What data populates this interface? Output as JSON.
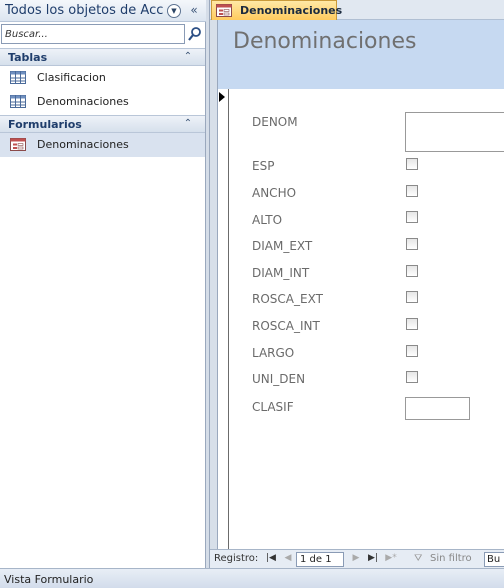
{
  "nav": {
    "title": "Todos los objetos de Acc...",
    "search_placeholder": "Buscar...",
    "groups": [
      {
        "label": "Tablas",
        "items": [
          {
            "label": "Clasificacion",
            "icon": "table-icon"
          },
          {
            "label": "Denominaciones",
            "icon": "table-icon"
          }
        ]
      },
      {
        "label": "Formularios",
        "items": [
          {
            "label": "Denominaciones",
            "icon": "form-icon",
            "selected": true
          }
        ]
      }
    ]
  },
  "tab": {
    "label": "Denominaciones",
    "icon": "form-icon"
  },
  "form": {
    "title": "Denominaciones",
    "fields": {
      "denom": "DENOM",
      "esp": "ESP",
      "ancho": "ANCHO",
      "alto": "ALTO",
      "diam_ext": "DIAM_EXT",
      "diam_int": "DIAM_INT",
      "rosca_ext": "ROSCA_EXT",
      "rosca_int": "ROSCA_INT",
      "largo": "LARGO",
      "uni_den": "UNI_DEN",
      "clasif": "CLASIF"
    }
  },
  "record_nav": {
    "label": "Registro:",
    "position": "1 de 1",
    "filter_label": "Sin filtro",
    "search_text": "Bu"
  },
  "status": {
    "text": "Vista Formulario"
  },
  "colors": {
    "header_bg": "#c6d9f1",
    "tab_bg": "#ffc95a",
    "selected_item": "#d9e2ef"
  }
}
